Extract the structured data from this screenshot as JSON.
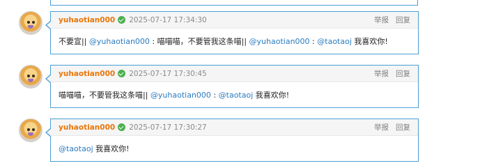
{
  "comments": [
    {
      "username": "yuhaotian000",
      "timestamp": "2025-07-17 17:34:30",
      "actions": {
        "report": "举报",
        "reply": "回复"
      },
      "content": {
        "t1": "不要宣|| ",
        "m1": "@yuhaotian000",
        "t2": " : 喵喵喵，不要管我这条喵|| ",
        "m2": "@yuhaotian000",
        "t3": " : ",
        "m3": "@taotaoj",
        "t4": " 我喜欢你!"
      }
    },
    {
      "username": "yuhaotian000",
      "timestamp": "2025-07-17 17:30:45",
      "actions": {
        "report": "举报",
        "reply": "回复"
      },
      "content": {
        "t1": "喵喵喵，不要管我这条喵|| ",
        "m1": "@yuhaotian000",
        "t2": " : ",
        "m2": "@taotaoj",
        "t3": " 我喜欢你!"
      }
    },
    {
      "username": "yuhaotian000",
      "timestamp": "2025-07-17 17:30:27",
      "actions": {
        "report": "举报",
        "reply": "回复"
      },
      "content": {
        "m1": "@taotaoj",
        "t1": " 我喜欢你!"
      }
    }
  ]
}
